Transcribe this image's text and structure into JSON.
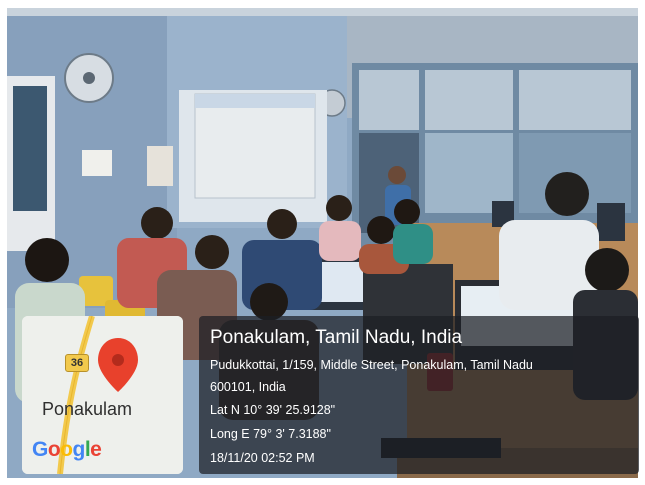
{
  "geotag": {
    "title": "Ponakulam, Tamil Nadu, India",
    "address_line1": "Pudukkottai, 1/159, Middle Street, Ponakulam, Tamil Nadu",
    "address_line2": "600101, India",
    "latitude": "Lat N 10° 39' 25.9128\"",
    "longitude": "Long E 79° 3' 7.3188\"",
    "datetime": "18/11/20 02:52 PM"
  },
  "map": {
    "road_number": "36",
    "place_name": "Ponakulam",
    "logo_text": "Google",
    "pin_color": "#e8412c",
    "road_color": "#f2c94c"
  },
  "photo": {
    "wall_color": "#8fa9c4",
    "projector_screen_color": "#e8ecee"
  }
}
